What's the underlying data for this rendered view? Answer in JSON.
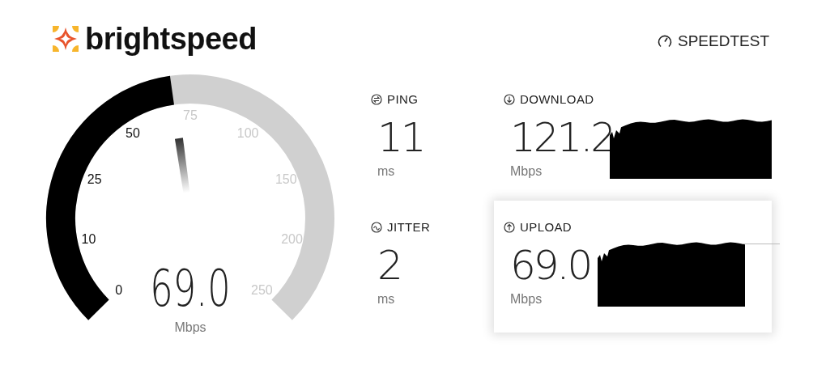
{
  "header": {
    "brand": "brightspeed",
    "product": "SPEEDTEST"
  },
  "gauge": {
    "reading": "69.0",
    "unit": "Mbps",
    "ticks": [
      {
        "label": "0",
        "passed": true
      },
      {
        "label": "10",
        "passed": true
      },
      {
        "label": "25",
        "passed": true
      },
      {
        "label": "50",
        "passed": true
      },
      {
        "label": "75",
        "passed": false
      },
      {
        "label": "100",
        "passed": false
      },
      {
        "label": "150",
        "passed": false
      },
      {
        "label": "200",
        "passed": false
      },
      {
        "label": "250",
        "passed": false
      }
    ]
  },
  "stats": [
    {
      "kind": "ping",
      "label": "PING",
      "value": "11",
      "unit": "ms",
      "selected": false
    },
    {
      "kind": "download",
      "label": "DOWNLOAD",
      "value": "121.2",
      "unit": "Mbps",
      "selected": false
    },
    {
      "kind": "jitter",
      "label": "JITTER",
      "value": "2",
      "unit": "ms",
      "selected": false
    },
    {
      "kind": "upload",
      "label": "UPLOAD",
      "value": "69.0",
      "unit": "Mbps",
      "selected": true
    }
  ]
}
